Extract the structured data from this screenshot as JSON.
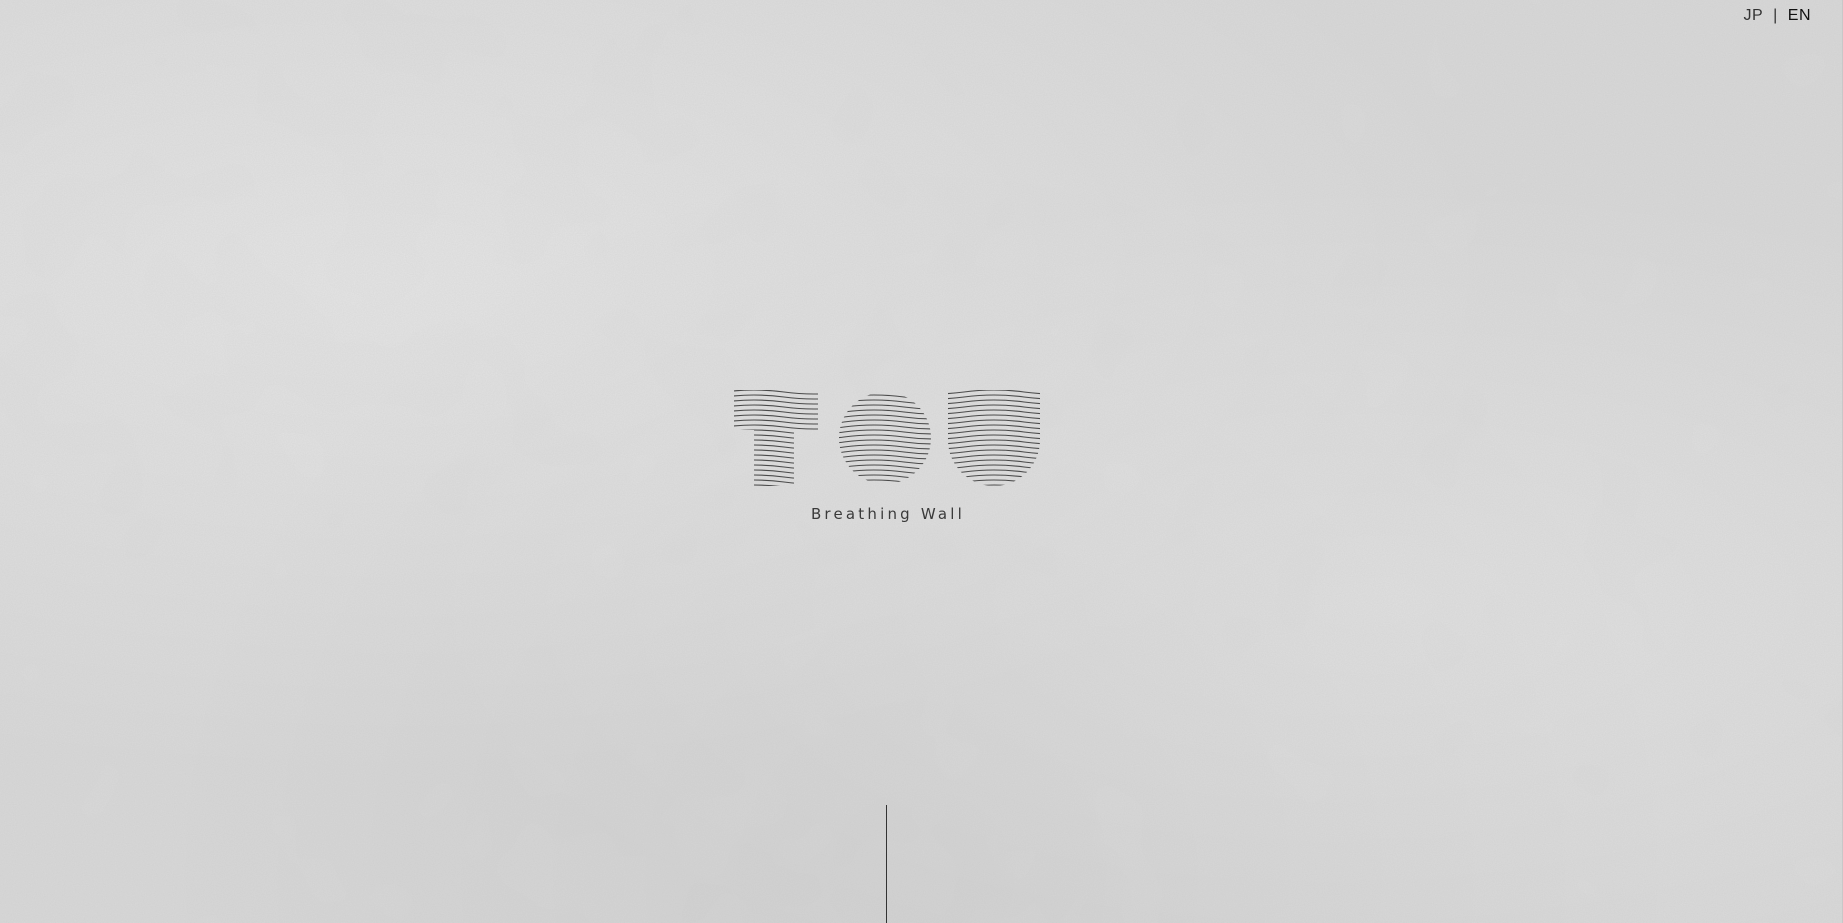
{
  "header": {
    "languages": [
      {
        "label": "JP",
        "active": false
      },
      {
        "label": "EN",
        "active": true
      }
    ],
    "separator": "|"
  },
  "hero": {
    "logo_text": "TOU",
    "tagline": "Breathing Wall"
  },
  "colors": {
    "background": "#d9d9d9",
    "logo_lines": "#4a4a4a",
    "text": "#3a3a3a"
  }
}
